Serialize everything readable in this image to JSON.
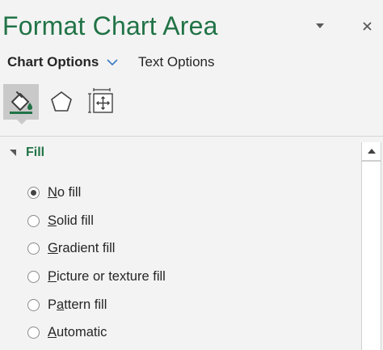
{
  "pane": {
    "title": "Format Chart Area"
  },
  "tabs": {
    "chart_options": "Chart Options",
    "text_options": "Text Options"
  },
  "icons": {
    "fill_line": "paint-bucket-icon",
    "effects": "pentagon-icon",
    "size_properties": "size-properties-icon"
  },
  "fill_section": {
    "title": "Fill",
    "options": [
      {
        "access_key": "N",
        "rest": "o fill",
        "selected": true
      },
      {
        "access_key": "S",
        "rest": "olid fill",
        "selected": false
      },
      {
        "access_key": "G",
        "rest": "radient fill",
        "selected": false
      },
      {
        "access_key": "P",
        "rest": "icture or texture fill",
        "selected": false
      },
      {
        "prefix": "P",
        "access_key": "a",
        "rest": "ttern fill",
        "selected": false
      },
      {
        "access_key": "A",
        "rest": "utomatic",
        "selected": false
      }
    ]
  },
  "colors": {
    "accent_green": "#217346",
    "pane_background": "#f3f3f3",
    "selected_icon_background": "#c9c9c9"
  }
}
